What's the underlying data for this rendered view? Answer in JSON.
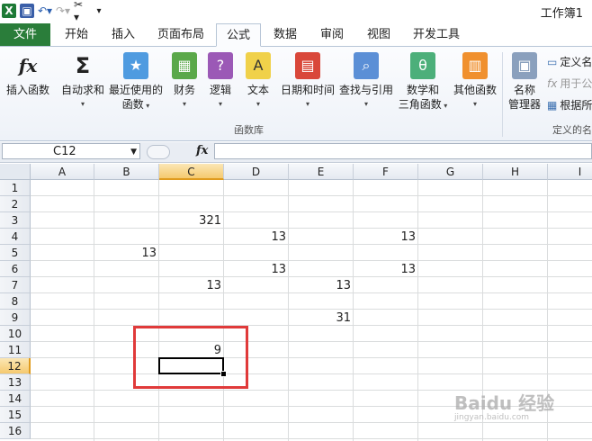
{
  "window": {
    "title": "工作簿1"
  },
  "tabs": [
    "文件",
    "开始",
    "插入",
    "页面布局",
    "公式",
    "数据",
    "审阅",
    "视图",
    "开发工具"
  ],
  "active_tab": "公式",
  "ribbon": {
    "buttons": {
      "insert_function": "插入函数",
      "autosum": "自动求和",
      "recent_1": "最近使用的",
      "recent_2": "函数",
      "financial": "财务",
      "logical": "逻辑",
      "text": "文本",
      "datetime": "日期和时间",
      "lookup": "查找与引用",
      "math_1": "数学和",
      "math_2": "三角函数",
      "more": "其他函数",
      "name_mgr_1": "名称",
      "name_mgr_2": "管理器"
    },
    "small": {
      "define": "定义名",
      "use": "用于公",
      "create": "根据所"
    },
    "group_library": "函数库",
    "group_names": "定义的名"
  },
  "formula_bar": {
    "name_box": "C12",
    "fx": "fx",
    "content": ""
  },
  "columns": [
    "A",
    "B",
    "C",
    "D",
    "E",
    "F",
    "G",
    "H",
    "I"
  ],
  "rows": [
    "1",
    "2",
    "3",
    "4",
    "5",
    "6",
    "7",
    "8",
    "9",
    "10",
    "11",
    "12",
    "13",
    "14",
    "15",
    "16"
  ],
  "cells": [
    {
      "ref": "C3",
      "value": "321"
    },
    {
      "ref": "D4",
      "value": "13"
    },
    {
      "ref": "F4",
      "value": "13"
    },
    {
      "ref": "B5",
      "value": "13"
    },
    {
      "ref": "D6",
      "value": "13"
    },
    {
      "ref": "F6",
      "value": "13"
    },
    {
      "ref": "C7",
      "value": "13"
    },
    {
      "ref": "E7",
      "value": "13"
    },
    {
      "ref": "E9",
      "value": "31"
    },
    {
      "ref": "C11",
      "value": "9"
    }
  ],
  "selected_cell": "C12",
  "watermark": {
    "text": "Baidu 经验",
    "sub": "jingyan.baidu.com"
  }
}
